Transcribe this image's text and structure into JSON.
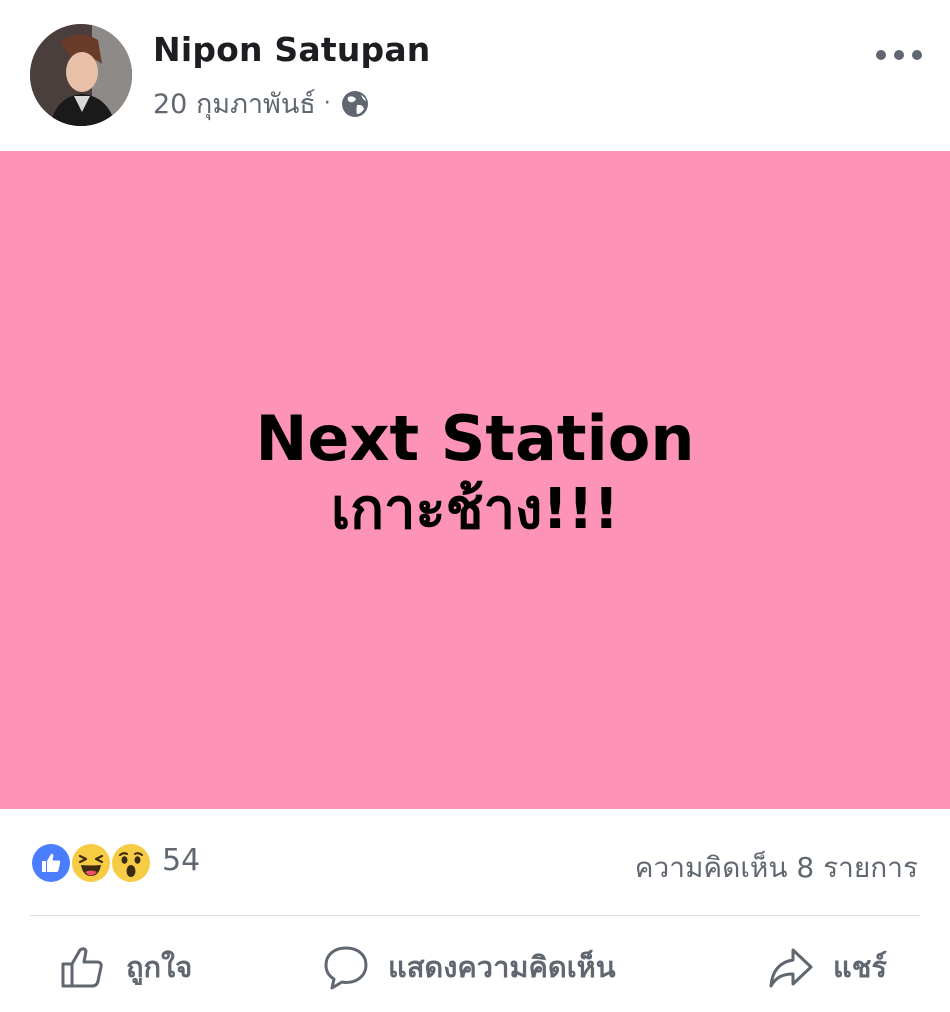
{
  "post": {
    "author": "Nipon Satupan",
    "date": "20 กุมภาพันธ์",
    "separator": "·",
    "privacy_icon": "globe-icon",
    "menu_icon": "more-options-icon",
    "background_color": "#fd93b7",
    "text_line_1": "Next Station",
    "text_line_2": "เกาะช้าง!!!"
  },
  "engagement": {
    "reactions": [
      "like-reaction-icon",
      "haha-reaction-icon",
      "wow-reaction-icon"
    ],
    "reaction_count": "54",
    "comment_count": "ความคิดเห็น 8 รายการ"
  },
  "actions": {
    "like_label": "ถูกใจ",
    "comment_label": "แสดงความคิดเห็น",
    "share_label": "แชร์"
  },
  "colors": {
    "like_blue": "#4a7dff",
    "emoji_yellow": "#f7cc45",
    "secondary_text": "#606770"
  }
}
